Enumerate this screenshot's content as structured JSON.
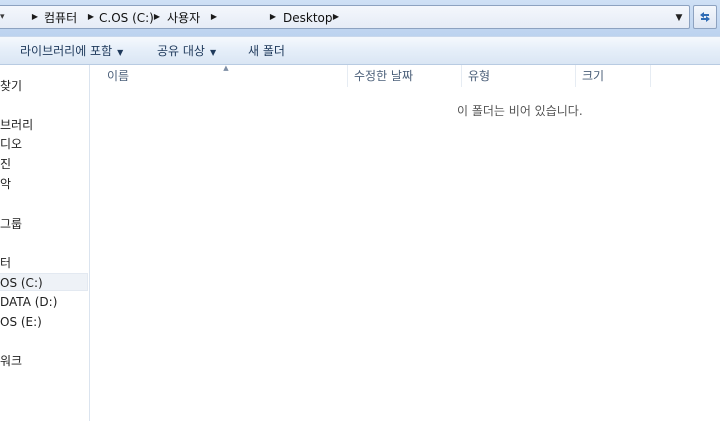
{
  "address_bar": {
    "crumbs": [
      "컴퓨터",
      "C.OS (C:)",
      "사용자",
      "Desktop"
    ]
  },
  "toolbar": {
    "include_library": "라이브러리에 포함",
    "share_with": "공유 대상",
    "new_folder": "새 폴더"
  },
  "nav": {
    "items": [
      "찾기",
      "브러리",
      "디오",
      "진",
      "악",
      "그룹",
      "터",
      "OS (C:)",
      "DATA (D:)",
      "OS (E:)",
      "워크"
    ],
    "selected_index": 7
  },
  "columns": {
    "name": "이름",
    "date_modified": "수정한 날짜",
    "type": "유형",
    "size": "크기"
  },
  "content": {
    "empty_message": "이 폴더는 비어 있습니다."
  },
  "colors": {
    "address_bg": "#bcd3ef",
    "toolbar_text": "#1e395b",
    "header_text": "#4c607a"
  }
}
